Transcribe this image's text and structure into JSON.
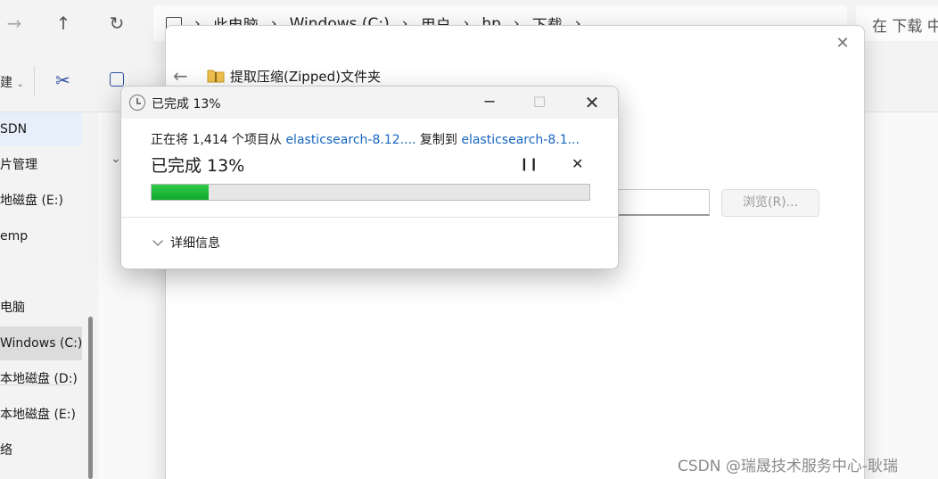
{
  "explorer": {
    "breadcrumb": [
      "此电脑",
      "Windows (C:)",
      "用户",
      "hp",
      "下载"
    ],
    "search_placeholder": "在 下载 中",
    "toolbar_new_label": "建",
    "sidebar_items": [
      "SDN",
      "片管理",
      "地磁盘 (E:)",
      "emp",
      "电脑",
      "Windows (C:)",
      "本地磁盘 (D:)",
      "本地磁盘 (E:)",
      "络"
    ]
  },
  "wizard": {
    "title": "提取压缩(Zipped)文件夹",
    "browse_label": "浏览(R)..."
  },
  "dialog": {
    "window_title": "已完成 13%",
    "copy_text_prefix": "正在将 1,414 个项目从 ",
    "source": "elasticsearch-8.12....",
    "copy_text_mid": " 复制到 ",
    "destination": "elasticsearch-8.1...",
    "progress_text": "已完成 13%",
    "progress_percent": 13,
    "details_label": "详细信息"
  },
  "watermark": "CSDN @瑞晟技术服务中心-耿瑞"
}
